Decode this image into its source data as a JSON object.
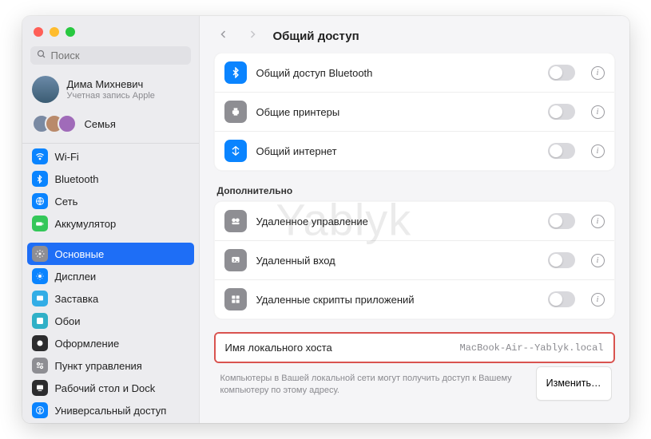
{
  "watermark": "Yablyk",
  "search": {
    "placeholder": "Поиск"
  },
  "account": {
    "name": "Дима Михневич",
    "subtitle": "Учетная запись Apple"
  },
  "family": {
    "label": "Семья"
  },
  "sidebar": {
    "group1": [
      {
        "label": "Wi-Fi"
      },
      {
        "label": "Bluetooth"
      },
      {
        "label": "Сеть"
      },
      {
        "label": "Аккумулятор"
      }
    ],
    "group2": [
      {
        "label": "Основные"
      },
      {
        "label": "Дисплеи"
      },
      {
        "label": "Заставка"
      },
      {
        "label": "Обои"
      },
      {
        "label": "Оформление"
      },
      {
        "label": "Пункт управления"
      },
      {
        "label": "Рабочий стол и Dock"
      },
      {
        "label": "Универсальный доступ"
      }
    ]
  },
  "header": {
    "title": "Общий доступ"
  },
  "mainRows": [
    {
      "label": "Общий доступ Bluetooth",
      "iconBg": "#0a84ff"
    },
    {
      "label": "Общие принтеры",
      "iconBg": "#8e8e93"
    },
    {
      "label": "Общий интернет",
      "iconBg": "#0a84ff"
    }
  ],
  "advanced": {
    "title": "Дополнительно",
    "rows": [
      {
        "label": "Удаленное управление",
        "iconBg": "#8e8e93"
      },
      {
        "label": "Удаленный вход",
        "iconBg": "#8e8e93"
      },
      {
        "label": "Удаленные скрипты приложений",
        "iconBg": "#8e8e93"
      }
    ]
  },
  "host": {
    "label": "Имя локального хоста",
    "value": "MacBook-Air--Yablyk.local",
    "help": "Компьютеры в Вашей локальной сети могут получить доступ к Вашему компьютеру по этому адресу.",
    "button": "Изменить…"
  }
}
